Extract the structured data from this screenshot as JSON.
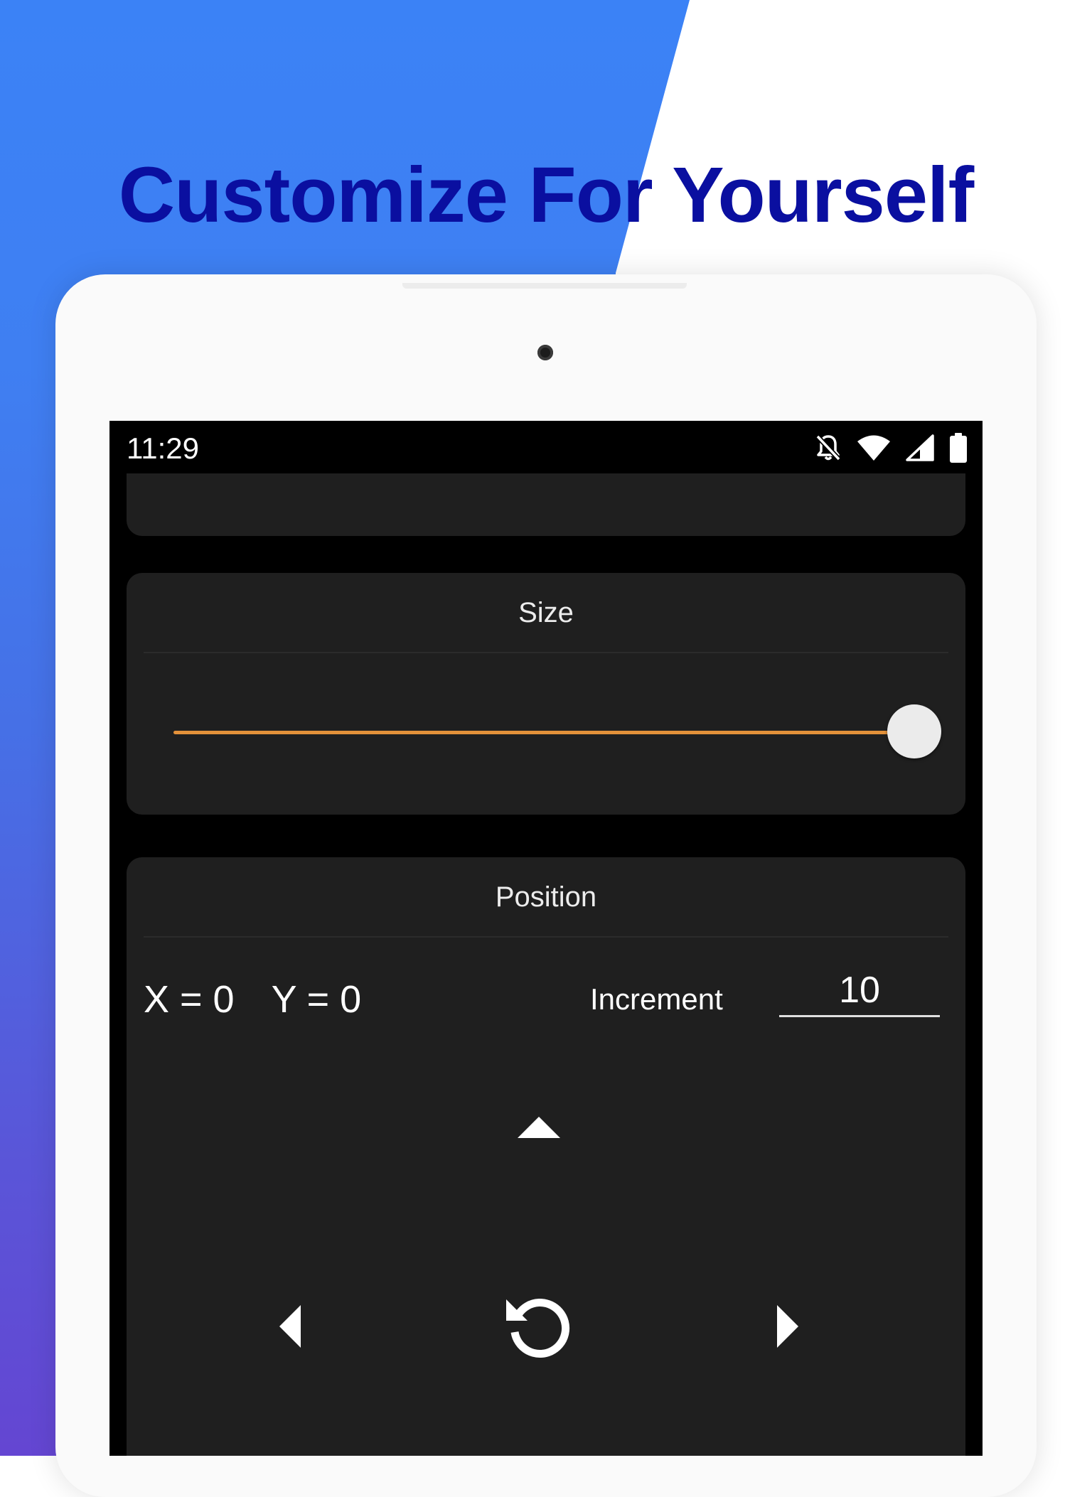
{
  "headline": "Customize For Yourself",
  "colors": {
    "headline": "#0a0fa0",
    "background_accent": "#3b82f6",
    "accent_orange": "#e3913a",
    "card": "#1f1f1f",
    "screen_bg": "#000000"
  },
  "status_bar": {
    "time": "11:29",
    "icons": [
      "notifications-off-icon",
      "wifi-icon",
      "cell-signal-icon",
      "battery-icon"
    ]
  },
  "size_card": {
    "title": "Size",
    "slider_value_fraction": 1.0
  },
  "position_card": {
    "title": "Position",
    "x_text": "X = 0",
    "y_text": "Y = 0",
    "increment_label": "Increment",
    "increment_value": "10",
    "controls": [
      "arrow-up-icon",
      "arrow-left-icon",
      "reset-icon",
      "arrow-right-icon"
    ]
  }
}
